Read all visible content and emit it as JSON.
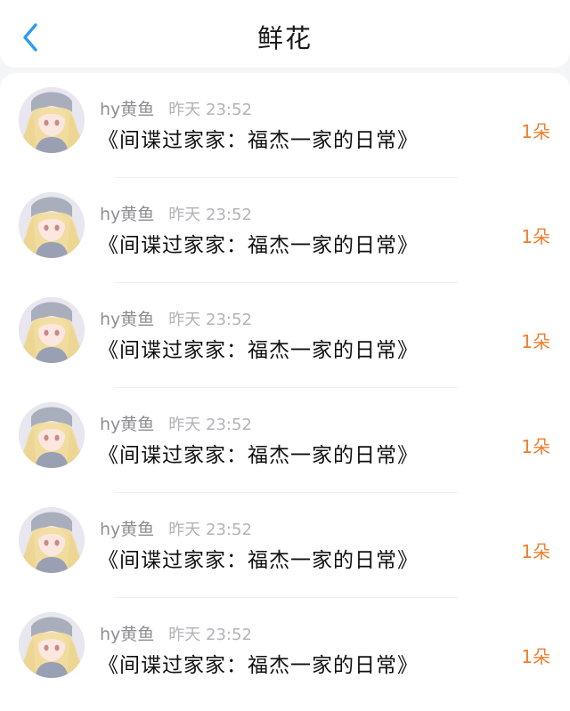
{
  "header": {
    "back_icon": "chevron-left-icon",
    "title": "鲜花",
    "accent_color": "#2f9bf0"
  },
  "records": [
    {
      "user": "hy黄鱼",
      "time": "昨天 23:52",
      "book": "《间谍过家家：福杰一家的日常》",
      "count": "1朵"
    },
    {
      "user": "hy黄鱼",
      "time": "昨天 23:52",
      "book": "《间谍过家家：福杰一家的日常》",
      "count": "1朵"
    },
    {
      "user": "hy黄鱼",
      "time": "昨天 23:52",
      "book": "《间谍过家家：福杰一家的日常》",
      "count": "1朵"
    },
    {
      "user": "hy黄鱼",
      "time": "昨天 23:52",
      "book": "《间谍过家家：福杰一家的日常》",
      "count": "1朵"
    },
    {
      "user": "hy黄鱼",
      "time": "昨天 23:52",
      "book": "《间谍过家家：福杰一家的日常》",
      "count": "1朵"
    },
    {
      "user": "hy黄鱼",
      "time": "昨天 23:52",
      "book": "《间谍过家家：福杰一家的日常》",
      "count": "1朵"
    }
  ],
  "colors": {
    "count": "#f07e2b",
    "username": "#8e8e93",
    "time": "#b3b3b8"
  }
}
